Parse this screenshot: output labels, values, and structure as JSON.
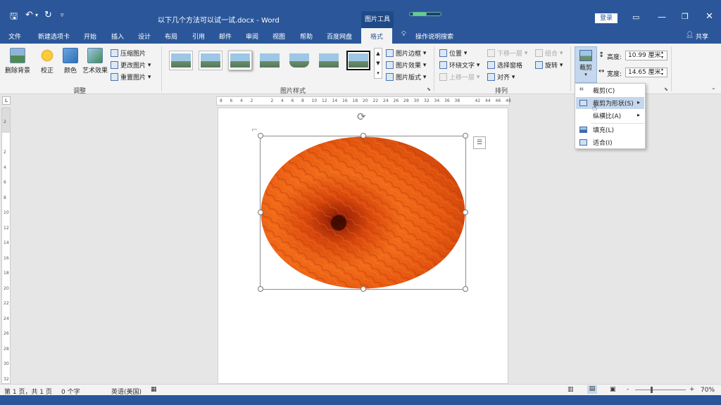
{
  "window": {
    "title": "以下几个方法可以试一试.docx - Word",
    "context_tab_group": "图片工具",
    "login_button": "登录",
    "share_label": "共享"
  },
  "tabs": [
    "文件",
    "新建选项卡",
    "开始",
    "插入",
    "设计",
    "布局",
    "引用",
    "邮件",
    "审阅",
    "视图",
    "帮助",
    "百度网盘"
  ],
  "active_tab": "格式",
  "tell_me": "操作说明搜索",
  "ribbon": {
    "adjust": {
      "label": "调整",
      "remove_bg": "删除背景",
      "corrections": "校正",
      "color": "颜色",
      "artistic": "艺术效果",
      "compress": "压缩图片",
      "change": "更改图片",
      "reset": "重置图片"
    },
    "styles": {
      "label": "图片样式",
      "border": "图片边框",
      "effects": "图片效果",
      "layout": "图片版式"
    },
    "arrange": {
      "label": "排列",
      "position": "位置",
      "wrap": "环绕文字",
      "forward": "上移一层",
      "backward": "下移一层",
      "selection_pane": "选择窗格",
      "align": "对齐",
      "group": "组合",
      "rotate": "旋转"
    },
    "size": {
      "crop": "裁剪",
      "height_label": "高度:",
      "height_value": "10.99 厘米",
      "width_label": "宽度:",
      "width_value": "14.65 厘米"
    }
  },
  "crop_menu": {
    "items": [
      {
        "label": "裁剪(C)",
        "submenu": false
      },
      {
        "label": "裁剪为形状(S)",
        "submenu": true
      },
      {
        "label": "纵横比(A)",
        "submenu": true
      },
      {
        "label": "填充(L)",
        "submenu": false
      },
      {
        "label": "适合(I)",
        "submenu": false
      }
    ]
  },
  "ruler": {
    "h_ticks": [
      "8",
      "6",
      "4",
      "2",
      "",
      "2",
      "4",
      "6",
      "8",
      "10",
      "12",
      "14",
      "16",
      "18",
      "20",
      "22",
      "24",
      "26",
      "28",
      "30",
      "32",
      "34",
      "36",
      "38",
      "",
      "42",
      "44",
      "46",
      "48"
    ],
    "v_ticks": [
      "2",
      "",
      "2",
      "4",
      "6",
      "8",
      "10",
      "12",
      "14",
      "16",
      "18",
      "20",
      "22",
      "24",
      "26",
      "28",
      "30",
      "32"
    ]
  },
  "status": {
    "page": "第 1 页，共 1 页",
    "words": "0 个字",
    "language": "英语(美国)",
    "zoom": "70%",
    "zoom_minus": "-",
    "zoom_plus": "+"
  },
  "colors": {
    "accent": "#2b579a",
    "ribbon_bg": "#f3f3f3",
    "flower": "#e85a10"
  }
}
